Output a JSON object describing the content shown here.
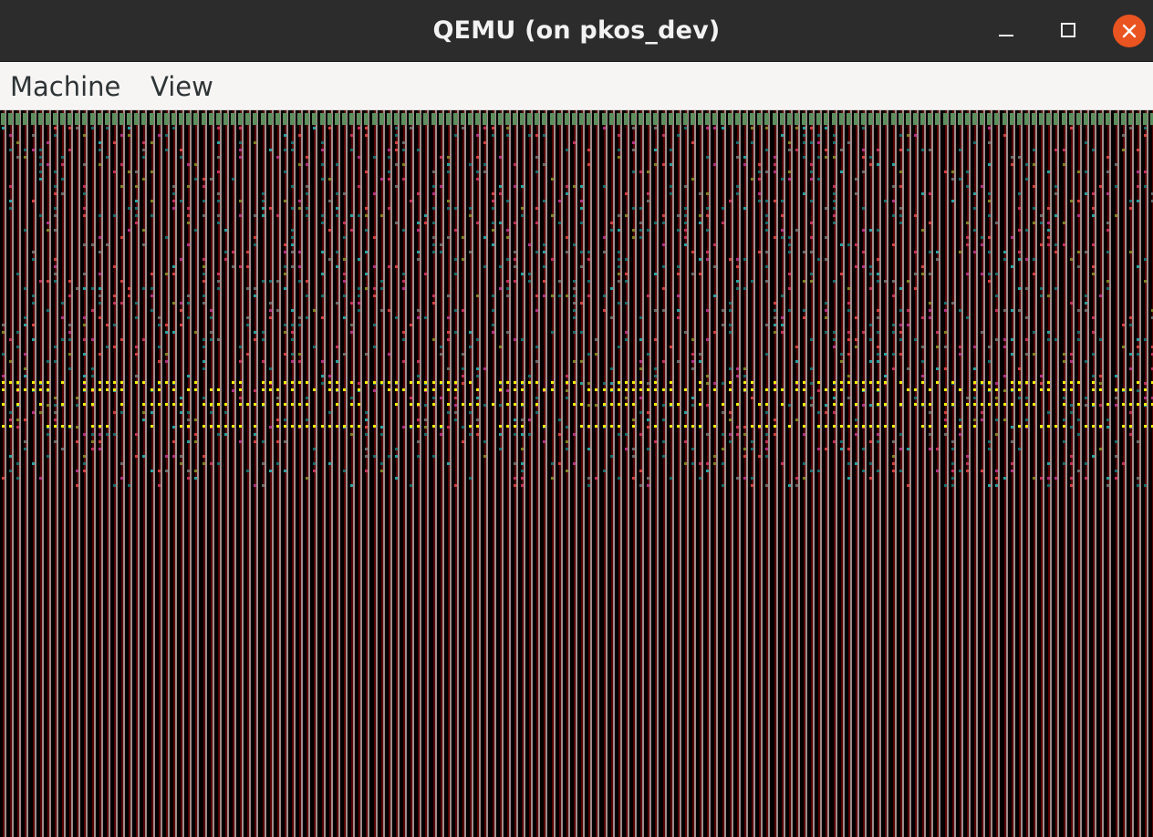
{
  "window": {
    "title": "QEMU (on pkos_dev)",
    "buttons": {
      "minimize": "minimize-icon",
      "maximize": "maximize-icon",
      "close": "close-icon"
    },
    "accent_close": "#e95420"
  },
  "menubar": {
    "items": [
      {
        "label": "Machine"
      },
      {
        "label": "View"
      }
    ]
  },
  "guest_display": {
    "description_colors": {
      "stripe_light": "#a08c8c",
      "stripe_dark": "#550000",
      "top_band": "#5f8f5f",
      "text_yellow": "#f0f000",
      "text_teal": "#1a6a6a"
    }
  }
}
